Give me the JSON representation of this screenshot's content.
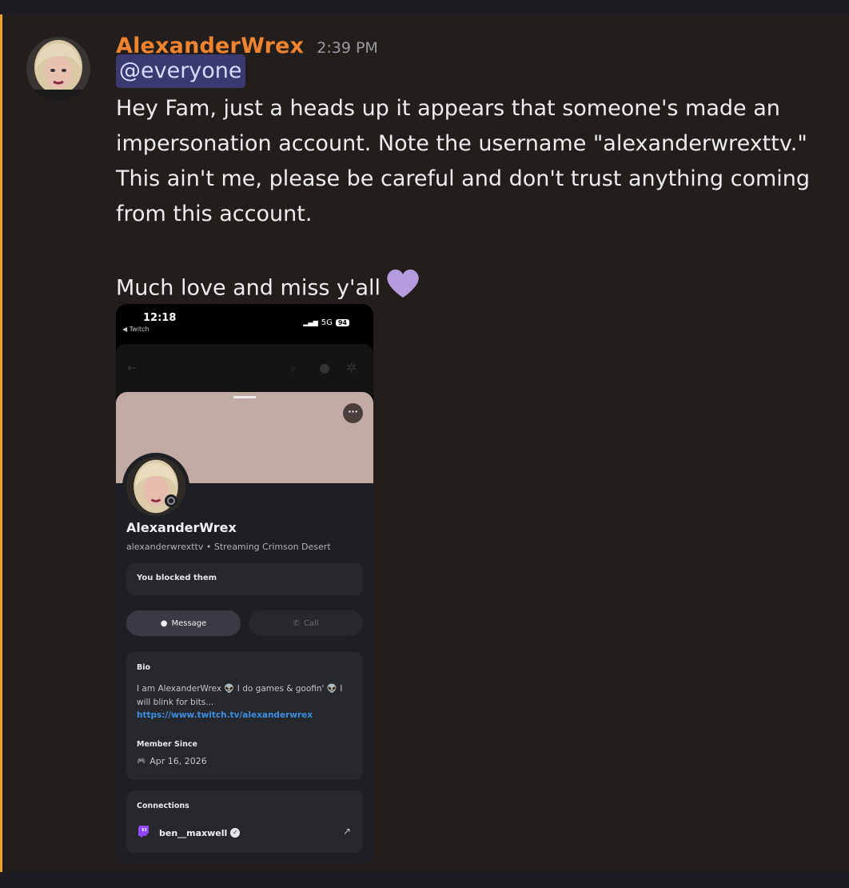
{
  "message": {
    "username": "AlexanderWrex",
    "timestamp": "2:39 PM",
    "mention": "@everyone",
    "lines": [
      "Hey Fam, just a heads up it appears that someone's made an",
      "impersonation account. Note the username \"alexanderwrexttv.\"",
      "This ain't me, please be careful and don't trust anything coming",
      "from this account."
    ],
    "closing": "Much love and miss y'all",
    "heart_icon": "purple-heart",
    "colors": {
      "username": "#f0832f",
      "mention_bg": "#3a3a70",
      "accent_border": "#f0a030"
    }
  },
  "phone": {
    "status": {
      "time": "12:18",
      "back_app": "◀ Twitch",
      "network": "5G",
      "battery": "94"
    },
    "profile": {
      "display_name": "AlexanderWrex",
      "username_line": "alexanderwrexttv • Streaming Crimson Desert",
      "blocked_text": "You blocked them",
      "message_label": "Message",
      "call_label": "Call",
      "bio_title": "Bio",
      "bio_text": "I am AlexanderWrex 👽 I do games & goofin' 👽 I will blink for bits...",
      "bio_link": "https://www.twitch.tv/alexanderwrex",
      "member_since_title": "Member Since",
      "member_since_date": "Apr 16, 2026",
      "connections_title": "Connections",
      "connection_name": "ben__maxwell"
    }
  }
}
